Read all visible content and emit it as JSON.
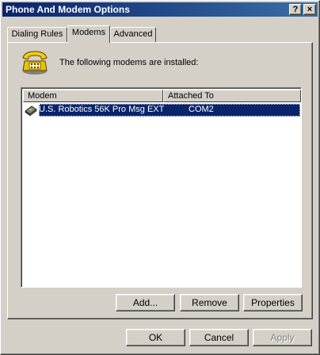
{
  "window": {
    "title": "Phone And Modem Options"
  },
  "titlebar": {
    "help_label": "?",
    "close_label": "×"
  },
  "tabs": [
    {
      "label": "Dialing Rules",
      "active": false
    },
    {
      "label": "Modems",
      "active": true
    },
    {
      "label": "Advanced",
      "active": false
    }
  ],
  "modems": {
    "intro_text": "The following modems are  installed:",
    "columns": [
      "Modem",
      "Attached To"
    ],
    "rows": [
      {
        "modem": "U.S. Robotics 56K Pro Msg EXT",
        "attached_to": "COM2",
        "selected": true
      }
    ],
    "buttons": {
      "add": "Add...",
      "remove": "Remove",
      "properties": "Properties"
    }
  },
  "dialog_buttons": {
    "ok": "OK",
    "cancel": "Cancel",
    "apply": "Apply",
    "apply_enabled": false
  },
  "colors": {
    "face": "#d4d0c8",
    "titlebar": "#0a246a",
    "selection": "#0a246a"
  },
  "icons": {
    "phone": "telephone-icon",
    "modem": "modem-icon"
  }
}
